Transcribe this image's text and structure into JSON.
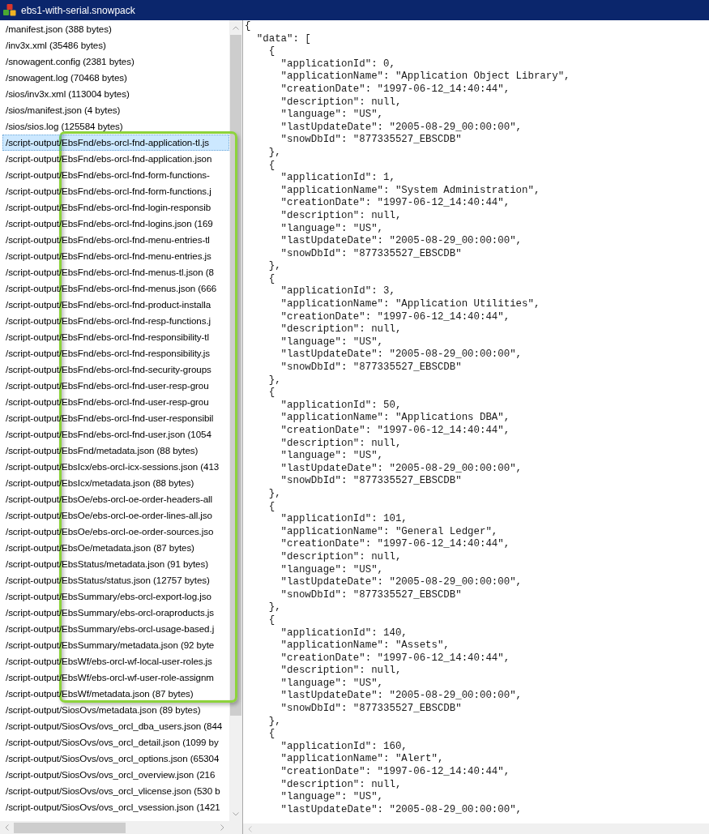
{
  "window": {
    "title": "ebs1-with-serial.snowpack"
  },
  "files": [
    {
      "label": "/manifest.json (388 bytes)",
      "selected": false
    },
    {
      "label": "/inv3x.xml (35486 bytes)",
      "selected": false
    },
    {
      "label": "/snowagent.config (2381 bytes)",
      "selected": false
    },
    {
      "label": "/snowagent.log (70468 bytes)",
      "selected": false
    },
    {
      "label": "/sios/inv3x.xml (113004 bytes)",
      "selected": false
    },
    {
      "label": "/sios/manifest.json (4 bytes)",
      "selected": false
    },
    {
      "label": "/sios/sios.log (125584 bytes)",
      "selected": false
    },
    {
      "label": "/script-output/EbsFnd/ebs-orcl-fnd-application-tl.js",
      "selected": true
    },
    {
      "label": "/script-output/EbsFnd/ebs-orcl-fnd-application.json",
      "selected": false
    },
    {
      "label": "/script-output/EbsFnd/ebs-orcl-fnd-form-functions-",
      "selected": false
    },
    {
      "label": "/script-output/EbsFnd/ebs-orcl-fnd-form-functions.j",
      "selected": false
    },
    {
      "label": "/script-output/EbsFnd/ebs-orcl-fnd-login-responsib",
      "selected": false
    },
    {
      "label": "/script-output/EbsFnd/ebs-orcl-fnd-logins.json (169",
      "selected": false
    },
    {
      "label": "/script-output/EbsFnd/ebs-orcl-fnd-menu-entries-tl",
      "selected": false
    },
    {
      "label": "/script-output/EbsFnd/ebs-orcl-fnd-menu-entries.js",
      "selected": false
    },
    {
      "label": "/script-output/EbsFnd/ebs-orcl-fnd-menus-tl.json (8",
      "selected": false
    },
    {
      "label": "/script-output/EbsFnd/ebs-orcl-fnd-menus.json (666",
      "selected": false
    },
    {
      "label": "/script-output/EbsFnd/ebs-orcl-fnd-product-installa",
      "selected": false
    },
    {
      "label": "/script-output/EbsFnd/ebs-orcl-fnd-resp-functions.j",
      "selected": false
    },
    {
      "label": "/script-output/EbsFnd/ebs-orcl-fnd-responsibility-tl",
      "selected": false
    },
    {
      "label": "/script-output/EbsFnd/ebs-orcl-fnd-responsibility.js",
      "selected": false
    },
    {
      "label": "/script-output/EbsFnd/ebs-orcl-fnd-security-groups",
      "selected": false
    },
    {
      "label": "/script-output/EbsFnd/ebs-orcl-fnd-user-resp-grou",
      "selected": false
    },
    {
      "label": "/script-output/EbsFnd/ebs-orcl-fnd-user-resp-grou",
      "selected": false
    },
    {
      "label": "/script-output/EbsFnd/ebs-orcl-fnd-user-responsibil",
      "selected": false
    },
    {
      "label": "/script-output/EbsFnd/ebs-orcl-fnd-user.json (1054",
      "selected": false
    },
    {
      "label": "/script-output/EbsFnd/metadata.json (88 bytes)",
      "selected": false
    },
    {
      "label": "/script-output/EbsIcx/ebs-orcl-icx-sessions.json (413",
      "selected": false
    },
    {
      "label": "/script-output/EbsIcx/metadata.json (88 bytes)",
      "selected": false
    },
    {
      "label": "/script-output/EbsOe/ebs-orcl-oe-order-headers-all",
      "selected": false
    },
    {
      "label": "/script-output/EbsOe/ebs-orcl-oe-order-lines-all.jso",
      "selected": false
    },
    {
      "label": "/script-output/EbsOe/ebs-orcl-oe-order-sources.jso",
      "selected": false
    },
    {
      "label": "/script-output/EbsOe/metadata.json (87 bytes)",
      "selected": false
    },
    {
      "label": "/script-output/EbsStatus/metadata.json (91 bytes)",
      "selected": false
    },
    {
      "label": "/script-output/EbsStatus/status.json (12757 bytes)",
      "selected": false
    },
    {
      "label": "/script-output/EbsSummary/ebs-orcl-export-log.jso",
      "selected": false
    },
    {
      "label": "/script-output/EbsSummary/ebs-orcl-oraproducts.js",
      "selected": false
    },
    {
      "label": "/script-output/EbsSummary/ebs-orcl-usage-based.j",
      "selected": false
    },
    {
      "label": "/script-output/EbsSummary/metadata.json (92 byte",
      "selected": false
    },
    {
      "label": "/script-output/EbsWf/ebs-orcl-wf-local-user-roles.js",
      "selected": false
    },
    {
      "label": "/script-output/EbsWf/ebs-orcl-wf-user-role-assignm",
      "selected": false
    },
    {
      "label": "/script-output/EbsWf/metadata.json (87 bytes)",
      "selected": false
    },
    {
      "label": "/script-output/SiosOvs/metadata.json (89 bytes)",
      "selected": false
    },
    {
      "label": "/script-output/SiosOvs/ovs_orcl_dba_users.json (844",
      "selected": false
    },
    {
      "label": "/script-output/SiosOvs/ovs_orcl_detail.json (1099 by",
      "selected": false
    },
    {
      "label": "/script-output/SiosOvs/ovs_orcl_options.json (65304",
      "selected": false
    },
    {
      "label": "/script-output/SiosOvs/ovs_orcl_overview.json (216",
      "selected": false
    },
    {
      "label": "/script-output/SiosOvs/ovs_orcl_vlicense.json (530 b",
      "selected": false
    },
    {
      "label": "/script-output/SiosOvs/ovs_orcl_vsession.json (1421",
      "selected": false
    }
  ],
  "json_view": {
    "root_open": "{",
    "data_key": "\"data\": [",
    "records": [
      {
        "open": "{",
        "fields": [
          "\"applicationId\": 0,",
          "\"applicationName\": \"Application Object Library\",",
          "\"creationDate\": \"1997-06-12_14:40:44\",",
          "\"description\": null,",
          "\"language\": \"US\",",
          "\"lastUpdateDate\": \"2005-08-29_00:00:00\",",
          "\"snowDbId\": \"877335527_EBSCDB\""
        ],
        "close": "},"
      },
      {
        "open": "{",
        "fields": [
          "\"applicationId\": 1,",
          "\"applicationName\": \"System Administration\",",
          "\"creationDate\": \"1997-06-12_14:40:44\",",
          "\"description\": null,",
          "\"language\": \"US\",",
          "\"lastUpdateDate\": \"2005-08-29_00:00:00\",",
          "\"snowDbId\": \"877335527_EBSCDB\""
        ],
        "close": "},"
      },
      {
        "open": "{",
        "fields": [
          "\"applicationId\": 3,",
          "\"applicationName\": \"Application Utilities\",",
          "\"creationDate\": \"1997-06-12_14:40:44\",",
          "\"description\": null,",
          "\"language\": \"US\",",
          "\"lastUpdateDate\": \"2005-08-29_00:00:00\",",
          "\"snowDbId\": \"877335527_EBSCDB\""
        ],
        "close": "},"
      },
      {
        "open": "{",
        "fields": [
          "\"applicationId\": 50,",
          "\"applicationName\": \"Applications DBA\",",
          "\"creationDate\": \"1997-06-12_14:40:44\",",
          "\"description\": null,",
          "\"language\": \"US\",",
          "\"lastUpdateDate\": \"2005-08-29_00:00:00\",",
          "\"snowDbId\": \"877335527_EBSCDB\""
        ],
        "close": "},"
      },
      {
        "open": "{",
        "fields": [
          "\"applicationId\": 101,",
          "\"applicationName\": \"General Ledger\",",
          "\"creationDate\": \"1997-06-12_14:40:44\",",
          "\"description\": null,",
          "\"language\": \"US\",",
          "\"lastUpdateDate\": \"2005-08-29_00:00:00\",",
          "\"snowDbId\": \"877335527_EBSCDB\""
        ],
        "close": "},"
      },
      {
        "open": "{",
        "fields": [
          "\"applicationId\": 140,",
          "\"applicationName\": \"Assets\",",
          "\"creationDate\": \"1997-06-12_14:40:44\",",
          "\"description\": null,",
          "\"language\": \"US\",",
          "\"lastUpdateDate\": \"2005-08-29_00:00:00\",",
          "\"snowDbId\": \"877335527_EBSCDB\""
        ],
        "close": "},"
      },
      {
        "open": "{",
        "fields": [
          "\"applicationId\": 160,",
          "\"applicationName\": \"Alert\",",
          "\"creationDate\": \"1997-06-12_14:40:44\",",
          "\"description\": null,",
          "\"language\": \"US\",",
          "\"lastUpdateDate\": \"2005-08-29_00:00:00\","
        ]
      }
    ]
  }
}
